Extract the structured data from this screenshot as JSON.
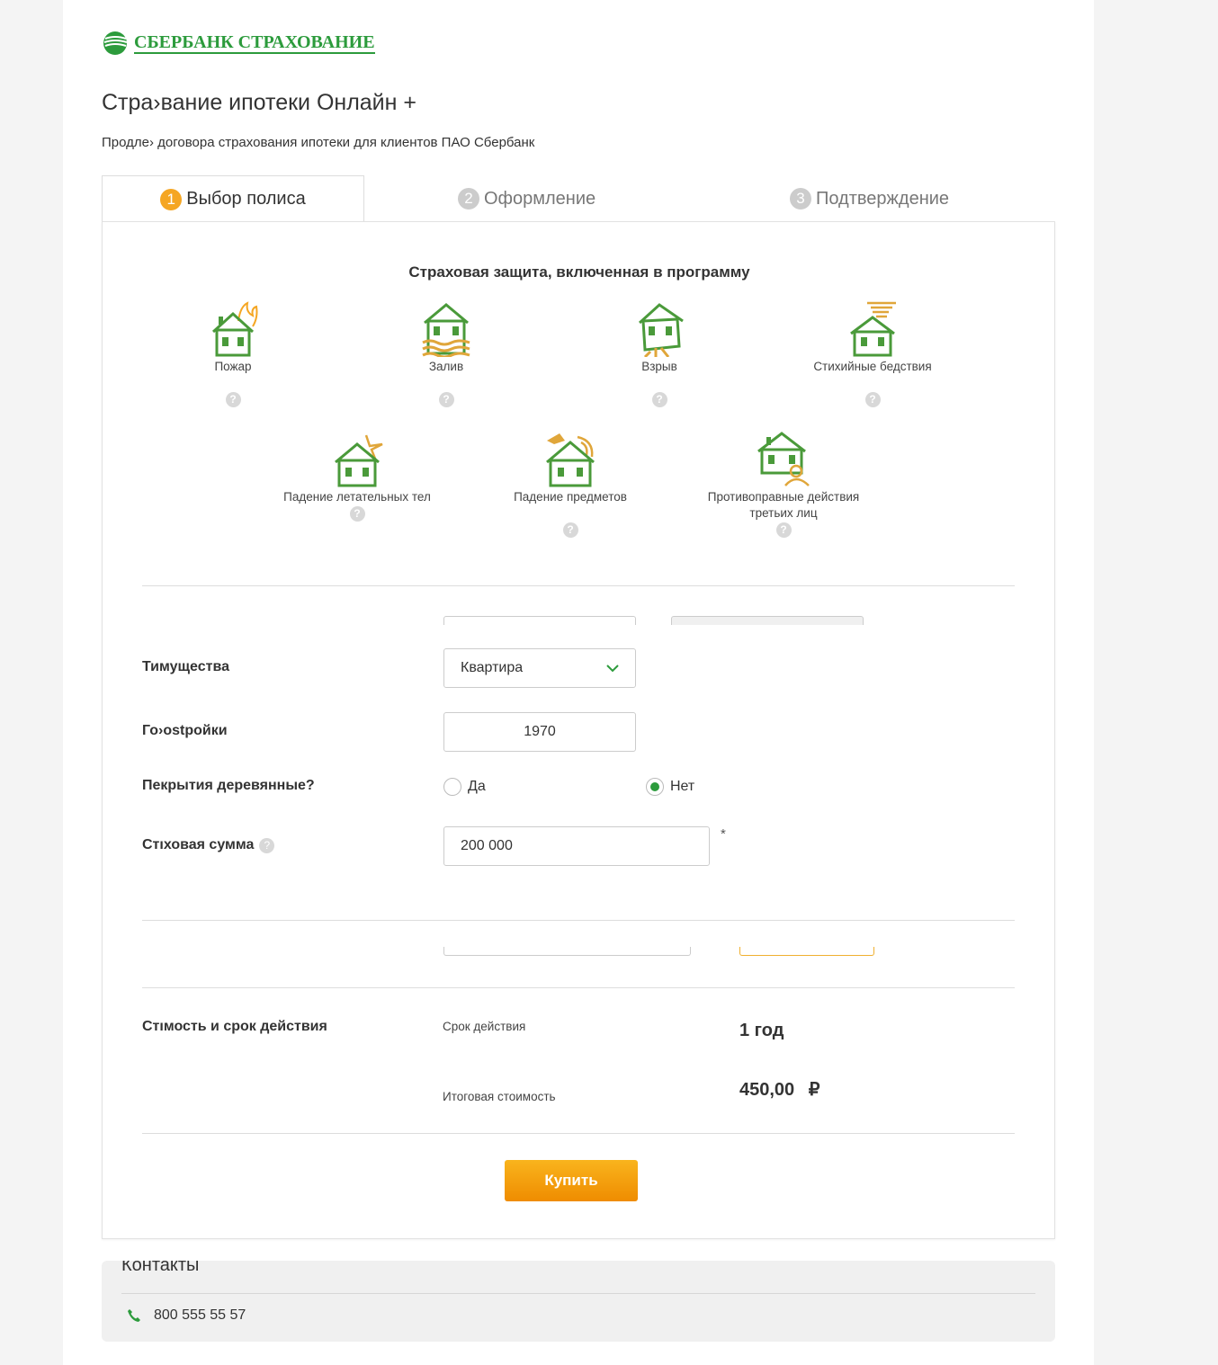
{
  "brand": {
    "name": "СБЕРБАНК СТРАХОВАНИЕ",
    "color": "#2c9b3c"
  },
  "header": {
    "title": "Стра›вание ипотеки Онлайн +",
    "subtitle": "Продле›  договора страхования ипотеки для клиентов ПАО Сбербанк"
  },
  "tabs": [
    {
      "num": "1",
      "label": "Выбор полиса",
      "active": true
    },
    {
      "num": "2",
      "label": "Оформление",
      "active": false
    },
    {
      "num": "3",
      "label": "Подтверждение",
      "active": false
    }
  ],
  "protection": {
    "title": "Страховая защита, включенная в программу",
    "risks": [
      {
        "label": "Пожар",
        "icon": "house-fire-icon"
      },
      {
        "label": "Залив",
        "icon": "house-flood-icon"
      },
      {
        "label": "Взрыв",
        "icon": "house-explosion-icon"
      },
      {
        "label": "Стихийные бедствия",
        "icon": "house-tornado-icon"
      },
      {
        "label": "Падение летательных тел",
        "icon": "house-aircraft-icon"
      },
      {
        "label": "Падение предметов",
        "icon": "house-falling-object-icon"
      },
      {
        "label": "Противоправные действия третьих лиц",
        "icon": "house-thief-icon"
      }
    ],
    "help_symbol": "?"
  },
  "form": {
    "property_type": {
      "label": "Тимущества",
      "value": "Квартира"
    },
    "build_year": {
      "label": "Го›ostройки",
      "value": "1970"
    },
    "wooden_floors": {
      "label": "Пекрытия деревянные?",
      "yes": "Да",
      "no": "Нет",
      "selected": "no"
    },
    "sum_insured": {
      "label": "Стıховая сумма",
      "value": "200 000",
      "required_mark": "*"
    }
  },
  "summary": {
    "label": "Стıмость и срок действия",
    "term_label": "Срок действия",
    "term_value": "1 год",
    "total_label": "Итоговая стоимость",
    "total_value": "450,00",
    "currency": "₽"
  },
  "buy_button": "Купить",
  "contacts": {
    "title": "Контакты",
    "phone": "800 555 55 57"
  }
}
